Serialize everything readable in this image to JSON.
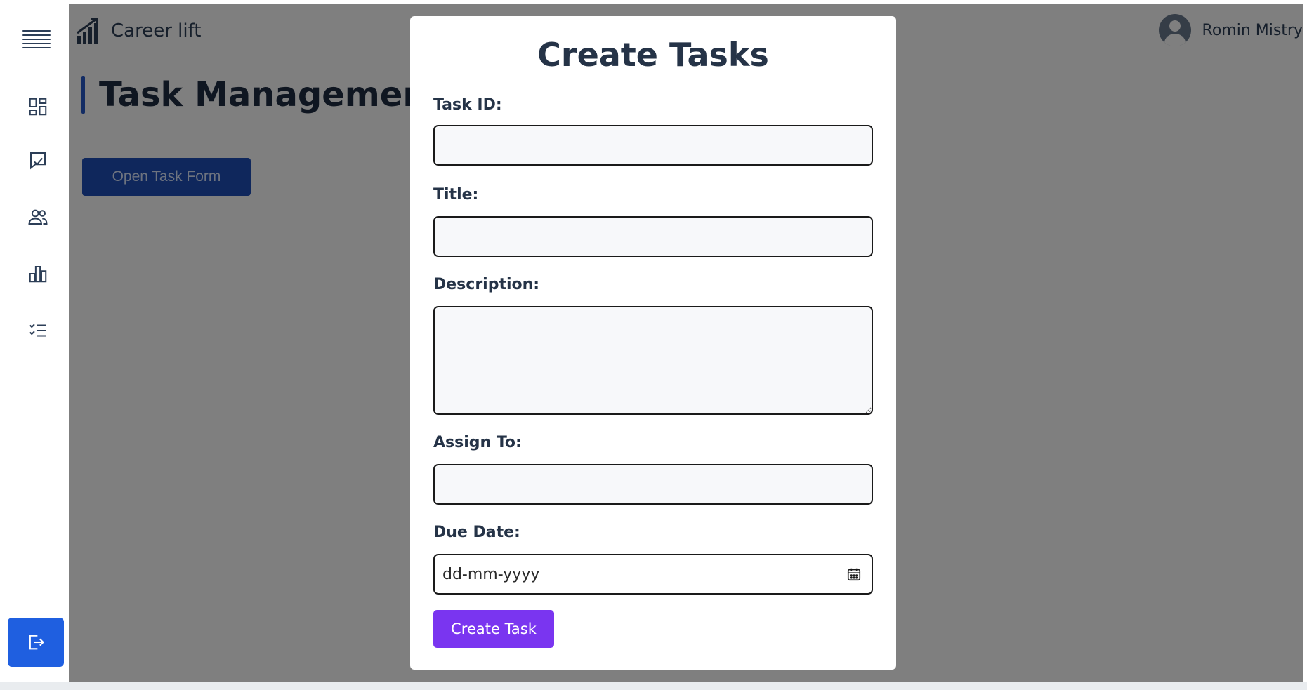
{
  "app": {
    "brand_name": "Career lift",
    "user_name": "Romin Mistry"
  },
  "sidebar": {
    "items": [
      {
        "icon": "menu-icon"
      },
      {
        "icon": "dashboard-icon"
      },
      {
        "icon": "task-check-icon"
      },
      {
        "icon": "users-icon"
      },
      {
        "icon": "bar-chart-icon"
      },
      {
        "icon": "checklist-icon"
      }
    ],
    "logout_icon": "logout-icon"
  },
  "page": {
    "title": "Task Management",
    "open_form_label": "Open Task Form"
  },
  "modal": {
    "title": "Create Tasks",
    "fields": {
      "task_id": {
        "label": "Task ID:",
        "value": ""
      },
      "title": {
        "label": "Title:",
        "value": ""
      },
      "description": {
        "label": "Description:",
        "value": ""
      },
      "assign_to": {
        "label": "Assign To:",
        "value": ""
      },
      "due_date": {
        "label": "Due Date:",
        "placeholder": "dd-mm-yyyy"
      }
    },
    "submit_label": "Create Task"
  },
  "colors": {
    "accent_purple": "#7a35f0",
    "primary_blue": "#1f4fb8",
    "logout_blue": "#1f5fe0",
    "text_dark": "#253347"
  }
}
